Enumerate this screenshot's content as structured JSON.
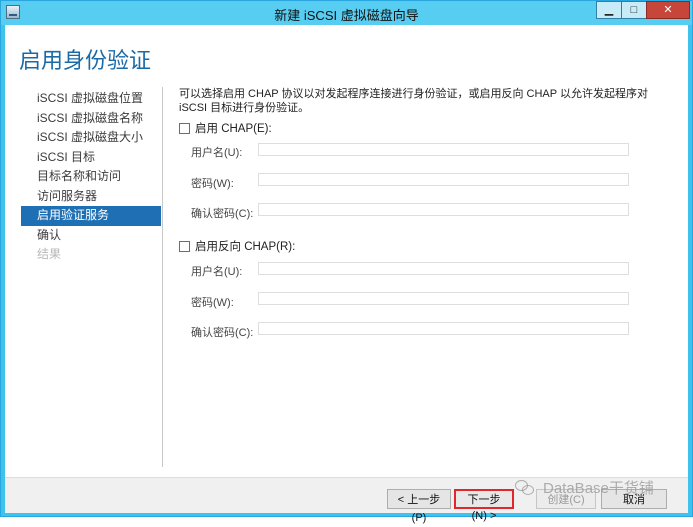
{
  "window": {
    "title": "新建 iSCSI 虚拟磁盘向导",
    "minimize": "▁",
    "maximize": "□",
    "close": "✕"
  },
  "page_title": "启用身份验证",
  "nav": {
    "items": [
      {
        "label": "iSCSI 虚拟磁盘位置",
        "state": "normal"
      },
      {
        "label": "iSCSI 虚拟磁盘名称",
        "state": "normal"
      },
      {
        "label": "iSCSI 虚拟磁盘大小",
        "state": "normal"
      },
      {
        "label": "iSCSI 目标",
        "state": "normal"
      },
      {
        "label": "目标名称和访问",
        "state": "normal"
      },
      {
        "label": "访问服务器",
        "state": "normal"
      },
      {
        "label": "启用验证服务",
        "state": "active"
      },
      {
        "label": "确认",
        "state": "normal"
      },
      {
        "label": "结果",
        "state": "disabled"
      }
    ]
  },
  "content": {
    "description": "可以选择启用 CHAP 协议以对发起程序连接进行身份验证，或启用反向 CHAP 以允许发起程序对 iSCSI 目标进行身份验证。",
    "chap": {
      "checkbox_label": "启用 CHAP(E):",
      "checked": false,
      "username_label": "用户名(U):",
      "password_label": "密码(W):",
      "confirm_label": "确认密码(C):"
    },
    "reverse_chap": {
      "checkbox_label": "启用反向 CHAP(R):",
      "checked": false,
      "username_label": "用户名(U):",
      "password_label": "密码(W):",
      "confirm_label": "确认密码(C):"
    }
  },
  "footer": {
    "prev": "< 上一步(P)",
    "next": "下一步(N) >",
    "create": "创建(C)",
    "cancel": "取消"
  },
  "watermark": {
    "text": "DataBase干货铺",
    "icon": "wechat-icon"
  },
  "colors": {
    "title_bar": "#57cdf1",
    "accent": "#1e6fb4",
    "page_title": "#1a6aa7",
    "next_highlight": "#e3262c"
  }
}
